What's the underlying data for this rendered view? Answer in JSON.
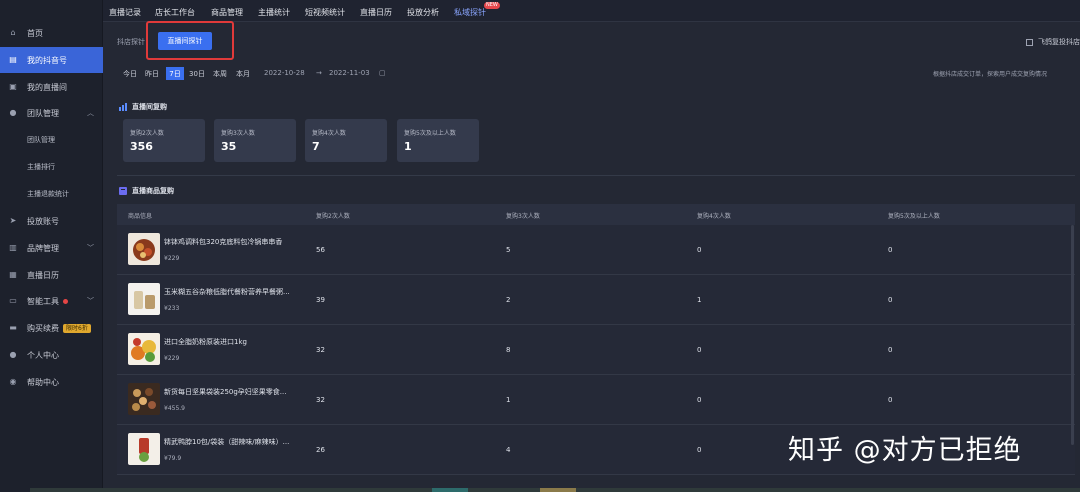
{
  "sidebar": {
    "items": [
      {
        "label": "首页",
        "icon": "home-icon"
      },
      {
        "label": "我的抖音号",
        "icon": "account-icon"
      },
      {
        "label": "我的直播间",
        "icon": "live-room-icon"
      },
      {
        "label": "团队管理",
        "icon": "team-icon"
      },
      {
        "label": "团队管理"
      },
      {
        "label": "主播排行"
      },
      {
        "label": "主播退款统计"
      },
      {
        "label": "投放账号",
        "icon": "ad-account-icon"
      },
      {
        "label": "品牌管理",
        "icon": "brand-icon"
      },
      {
        "label": "直播日历",
        "icon": "calendar-icon"
      },
      {
        "label": "智能工具",
        "icon": "tools-icon"
      },
      {
        "label": "购买续费",
        "icon": "purchase-icon",
        "badge": "限时6折"
      },
      {
        "label": "个人中心",
        "icon": "user-icon"
      },
      {
        "label": "帮助中心",
        "icon": "help-icon"
      }
    ]
  },
  "topnav": {
    "items": [
      "直播记录",
      "店长工作台",
      "商品管理",
      "主播统计",
      "短视频统计",
      "直播日历",
      "投放分析",
      "私域探针"
    ],
    "new_badge": "NEW"
  },
  "subtabs": {
    "tab1": "抖店探针",
    "tab2": "直播间探针",
    "right_option": "飞鸽复投抖店"
  },
  "datebar": {
    "buttons": [
      "今日",
      "昨日",
      "7日",
      "30日",
      "本周",
      "本月"
    ],
    "active": "7日",
    "start": "2022-10-28",
    "arrow": "→",
    "end": "2022-11-03",
    "hint": "根据抖店成交订单，探索用户成交复购情况"
  },
  "repurchase": {
    "title": "直播间复购",
    "cards": [
      {
        "label": "复购2次人数",
        "value": "356"
      },
      {
        "label": "复购3次人数",
        "value": "35"
      },
      {
        "label": "复购4次人数",
        "value": "7"
      },
      {
        "label": "复购5次及以上人数",
        "value": "1"
      }
    ]
  },
  "product_section": {
    "title": "直播商品复购",
    "headers": [
      "商品信息",
      "复购2次人数",
      "复购3次人数",
      "复购4次人数",
      "复购5次及以上人数"
    ],
    "rows": [
      {
        "name": "钵钵鸡调料包320克底料包冷锅串串香",
        "price": "¥229",
        "c2": "56",
        "c3": "5",
        "c4": "0",
        "c5": "0"
      },
      {
        "name": "玉米糊五谷杂粮低脂代餐粉营养早餐粥...",
        "price": "¥233",
        "c2": "39",
        "c3": "2",
        "c4": "1",
        "c5": "0"
      },
      {
        "name": "进口全脂奶粉原装进口1kg",
        "price": "¥229",
        "c2": "32",
        "c3": "8",
        "c4": "0",
        "c5": "0"
      },
      {
        "name": "新货每日坚果袋装250g孕妇坚果零食...",
        "price": "¥455.9",
        "c2": "32",
        "c3": "1",
        "c4": "0",
        "c5": "0"
      },
      {
        "name": "精武鸭脖10包/袋装（甜辣味/麻辣味）...",
        "price": "¥79.9",
        "c2": "26",
        "c3": "4",
        "c4": "0",
        "c5": "0"
      }
    ]
  },
  "watermark": "知乎 @对方已拒绝"
}
